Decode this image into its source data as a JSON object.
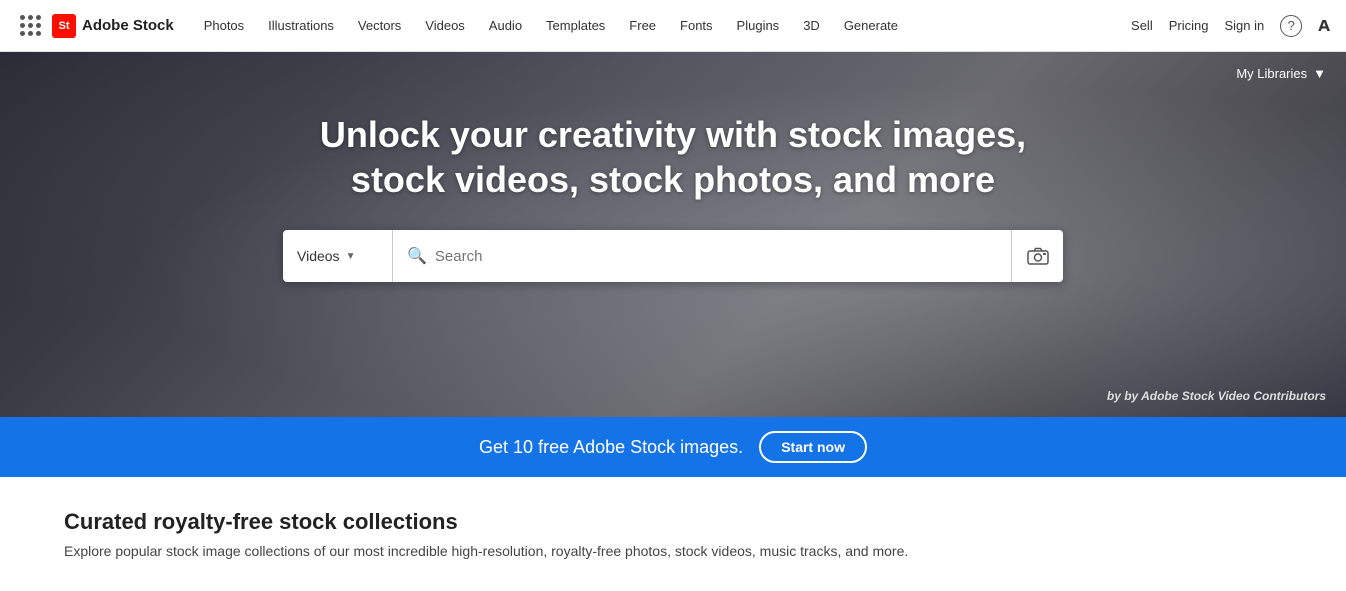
{
  "nav": {
    "logo_badge": "St",
    "logo_text": "Adobe Stock",
    "links": [
      {
        "label": "Photos",
        "id": "photos"
      },
      {
        "label": "Illustrations",
        "id": "illustrations"
      },
      {
        "label": "Vectors",
        "id": "vectors"
      },
      {
        "label": "Videos",
        "id": "videos"
      },
      {
        "label": "Audio",
        "id": "audio"
      },
      {
        "label": "Templates",
        "id": "templates"
      },
      {
        "label": "Free",
        "id": "free"
      },
      {
        "label": "Fonts",
        "id": "fonts"
      },
      {
        "label": "Plugins",
        "id": "plugins"
      },
      {
        "label": "3D",
        "id": "3d"
      },
      {
        "label": "Generate",
        "id": "generate"
      }
    ],
    "right_links": [
      {
        "label": "Sell",
        "id": "sell"
      },
      {
        "label": "Pricing",
        "id": "pricing"
      },
      {
        "label": "Sign in",
        "id": "sign-in"
      }
    ]
  },
  "hero": {
    "my_libraries": "My Libraries",
    "title_line1": "Unlock your creativity with stock images,",
    "title_line2": "stock videos, stock photos, and more",
    "search_dropdown_label": "Videos",
    "search_placeholder": "Search",
    "attribution": "by Adobe Stock Video Contributors"
  },
  "promo": {
    "text": "Get 10 free Adobe Stock images.",
    "button_label": "Start now"
  },
  "bottom": {
    "title": "Curated royalty-free stock collections",
    "subtitle": "Explore popular stock image collections of our most incredible high-resolution, royalty-free photos, stock videos, music tracks, and more."
  }
}
